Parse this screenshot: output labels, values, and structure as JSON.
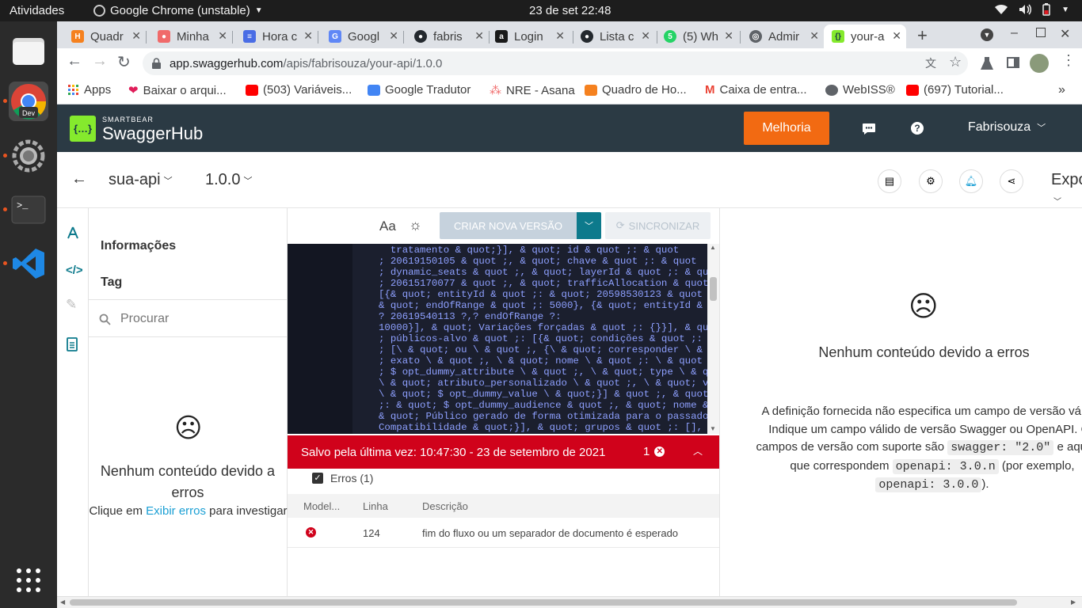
{
  "system": {
    "activities": "Atividades",
    "app_name": "Google Chrome (unstable)",
    "clock": "23 de set  22:48"
  },
  "tabs": [
    {
      "label": "Quadr",
      "color": "#f5811f",
      "glyph": "H"
    },
    {
      "label": "Minha",
      "color": "#f06a6a",
      "glyph": "●"
    },
    {
      "label": "Hora c",
      "color": "#4a6de5",
      "glyph": "≡"
    },
    {
      "label": "Googl",
      "color": "#5f87f6",
      "glyph": "G"
    },
    {
      "label": "fabris",
      "color": "#24292e",
      "glyph": "●"
    },
    {
      "label": "Login",
      "color": "#1a1a1a",
      "glyph": "a"
    },
    {
      "label": "Lista c",
      "color": "#24292e",
      "glyph": "●"
    },
    {
      "label": "(5) Wh",
      "color": "#25d366",
      "glyph": "5"
    },
    {
      "label": "Admir",
      "color": "#5f6368",
      "glyph": "◎"
    },
    {
      "label": "your-a",
      "color": "#85ea2d",
      "glyph": "{}"
    }
  ],
  "address": {
    "domain": "app.swaggerhub.com",
    "path": "/apis/fabrisouza/your-api/1.0.0"
  },
  "bookmarks": [
    {
      "label": "Apps",
      "color": "#ea4335"
    },
    {
      "label": "Baixar o arqui...",
      "color": "#e01e5a"
    },
    {
      "label": "(503) Variáveis...",
      "color": "#ff0000"
    },
    {
      "label": "Google Tradutor",
      "color": "#4285f4"
    },
    {
      "label": "NRE - Asana",
      "color": "#f06a6a"
    },
    {
      "label": "Quadro de Ho...",
      "color": "#f5811f"
    },
    {
      "label": "Caixa de entra...",
      "color": "#ea4335"
    },
    {
      "label": "WebISS®",
      "color": "#5f6368"
    },
    {
      "label": "(697) Tutorial...",
      "color": "#ff0000"
    }
  ],
  "swaggerhub": {
    "brand_small": "SMARTBEAR",
    "brand": "SwaggerHub",
    "improve_button": "Melhoria",
    "user": "Fabrisouza",
    "api_name": "sua-api",
    "version": "1.0.0",
    "export": "Expo"
  },
  "nav": {
    "info": "Informações",
    "tag": "Tag",
    "search_placeholder": "Procurar",
    "empty_title": "Nenhum conteúdo devido a erros",
    "empty_hint_pre": "Clique em ",
    "empty_hint_link": "Exibir erros",
    "empty_hint_post": " para investigar"
  },
  "editor": {
    "font_toggle": "Aa",
    "new_version": "CRIAR NOVA VERSÃO",
    "sync": "SINCRONIZAR",
    "code_lines": [
      "  tratamento & quot;}], & quot; id & quot ;: & quot",
      "; 20619150105 & quot ;, & quot; chave & quot ;: & quot",
      "; dynamic_seats & quot ;, & quot; layerId & quot ;: & quot;",
      "; 20615170077 & quot ;, & quot; trafficAllocation & quot ;:",
      "[{& quot; entityId & quot ;: & quot; 20598530123 & quot ;,",
      "& quot; endOfRange & quot ;: 5000}, {& quot; entityId & quo",
      "? 20619540113 ?,? endOfRange ?:",
      "10000}], & quot; Variações forçadas & quot ;: {}}], & quot",
      "; públicos-alvo & quot ;: [{& quot; condições & quot ;: & q",
      "; [\\ & quot; ou \\ & quot ;, {\\ & quot; corresponder \\ & quo",
      "; exato \\ & quot ;, \\ & quot; nome \\ & quot ;: \\ & quot",
      "; $ opt_dummy_attribute \\ & quot ;, \\ & quot; type \\ & quot",
      "\\ & quot; atributo_personalizado \\ & quot ;, \\ & quot; valo",
      "\\ & quot; $ opt_dummy_value \\ & quot;}] & quot ;, & quot; i",
      ";: & quot; $ opt_dummy_audience & quot ;, & quot; nome & q",
      "& quot; Público gerado de forma otimizada para o passado",
      "Compatibilidade & quot;}], & quot; grupos & quot ;: [], & q"
    ],
    "saved": "Salvo pela última vez: 10:47:30   -   23 de setembro de 2021",
    "error_count": "1",
    "errors_label": "Erros (1)",
    "col_model": "Model...",
    "col_line": "Linha",
    "col_desc": "Descrição",
    "error_line": "124",
    "error_desc": "fim do fluxo ou um separador de documento é esperado"
  },
  "preview": {
    "title": "Nenhum conteúdo devido a erros",
    "p1": "A definição fornecida não especifica um campo de versão válido.",
    "p2": "Indique um campo válido de versão Swagger ou OpenAPI. Os",
    "p3a": "campos de versão com suporte são ",
    "code1": "swagger: \"2.0\"",
    "p3b": " e aqueles",
    "p4a": "que correspondem ",
    "code2": "openapi: 3.0.n",
    "p4b": " (por exemplo,",
    "code3": "openapi: 3.0.0",
    "p5": ")."
  },
  "colors": {
    "header": "#2b3a44",
    "orange": "#f26a12",
    "error": "#d0021b",
    "teal": "#0d7a8c"
  }
}
